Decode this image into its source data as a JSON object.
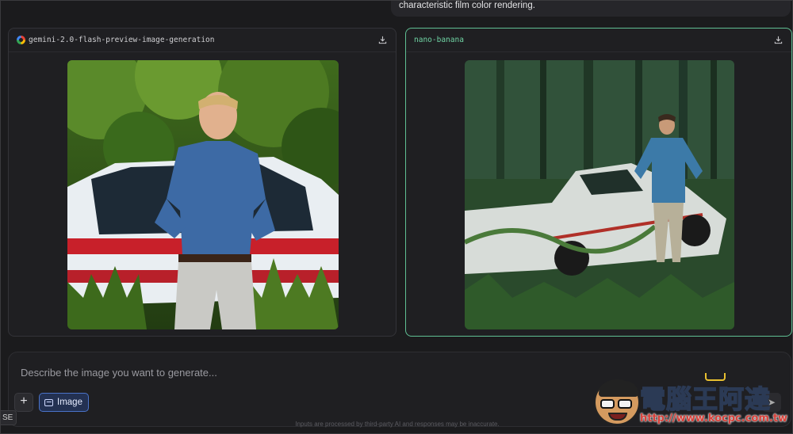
{
  "top_message": {
    "text": "characteristic film color rendering."
  },
  "panels": [
    {
      "model_name": "gemini-2.0-flash-preview-image-generation",
      "provider_icon": "google-g-icon",
      "download_icon": "download-icon"
    },
    {
      "model_name": "nano-banana",
      "download_icon": "download-icon",
      "accent": "#5fbf93"
    }
  ],
  "prompt": {
    "placeholder": "Describe the image you want to generate...",
    "add_label": "+",
    "image_button_label": "Image"
  },
  "disclaimer": "Inputs are processed by third-party AI and responses may be inaccurate.",
  "edge_tag": "SE",
  "watermark": {
    "title": "電腦王阿達",
    "url": "http://www.kocpc.com.tw"
  },
  "colors": {
    "background": "#1b1b1d",
    "panel": "#1f1f22",
    "accent_green": "#5fbf93",
    "accent_blue": "#4a73c9"
  }
}
